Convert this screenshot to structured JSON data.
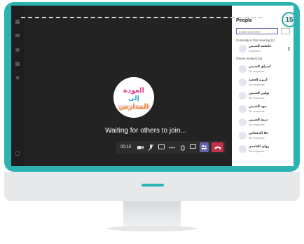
{
  "step": {
    "number": "15"
  },
  "meeting": {
    "waiting_text": "Waiting for others to join...",
    "elapsed": "00:13",
    "avatar_lines": [
      "العودة",
      "إلى",
      "المدارس"
    ]
  },
  "people_panel": {
    "title": "People",
    "invite_placeholder": "Invite someone",
    "current_section": "Currently in this meeting (1)",
    "organizer": {
      "name": "فاطمة العتيبي",
      "role": "Organizer"
    },
    "others_section": "Others invited (10)",
    "invited": [
      {
        "name": "اشراق العتيبي",
        "status": "No response"
      },
      {
        "name": "أميرة الجعيد",
        "status": "No response"
      },
      {
        "name": "تولين العتيبي",
        "status": "No response"
      },
      {
        "name": "جود العتيبي",
        "status": "No response"
      },
      {
        "name": "ديمة العتيبي",
        "status": "No response"
      },
      {
        "name": "حلا الدعجاني",
        "status": "No response"
      },
      {
        "name": "روان الغامدي",
        "status": "No response"
      }
    ]
  },
  "colors": {
    "frame_teal": "#2bb3b1",
    "teams_purple": "#6264a7",
    "hangup_red": "#c4314b"
  }
}
